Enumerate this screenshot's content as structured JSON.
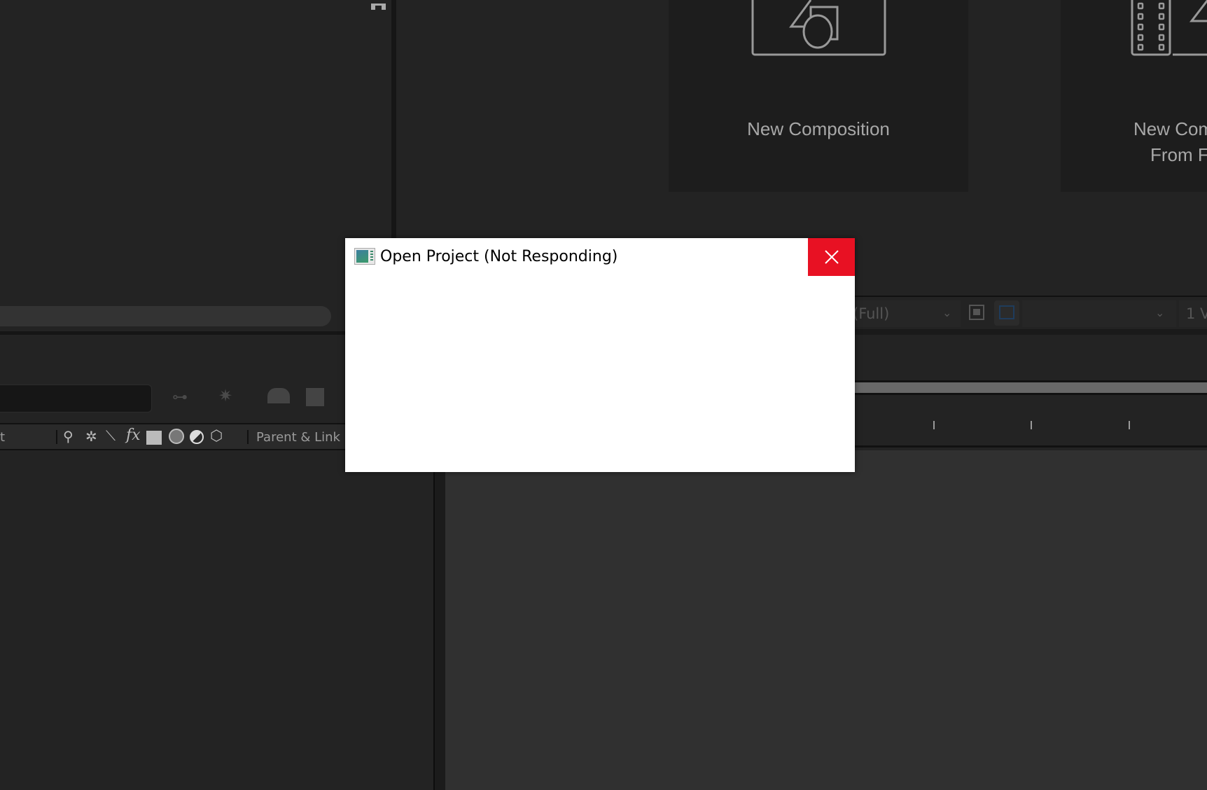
{
  "start_panel": {
    "cards": [
      {
        "label": "New Composition",
        "icon": "composition-icon"
      },
      {
        "label_line1": "New Com",
        "label_line2": "From F",
        "icon": "composition-from-footage-icon"
      }
    ]
  },
  "viewer_toolbar": {
    "resolution_value": "(Full)",
    "views_value": "1 V"
  },
  "timeline": {
    "column_partial": "t",
    "parent_link_label": "Parent & Link"
  },
  "dialog": {
    "title": "Open Project (Not Responding)",
    "close_color": "#e81123"
  }
}
